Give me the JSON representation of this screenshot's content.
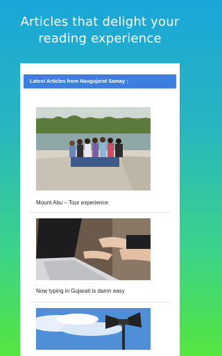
{
  "promo": {
    "headline_line1": "Articles that delight your",
    "headline_line2": "reading experience"
  },
  "app": {
    "section_title": "Latest Articles from Navgujarat Samay :",
    "articles": [
      {
        "title": "Mount Abu – Tour experience",
        "image": "group-photo-by-lake"
      },
      {
        "title": "Now typing in Gujarati is damn easy",
        "image": "hands-typing-on-laptop"
      },
      {
        "title": "",
        "image": "loudspeaker-against-sky"
      }
    ]
  }
}
